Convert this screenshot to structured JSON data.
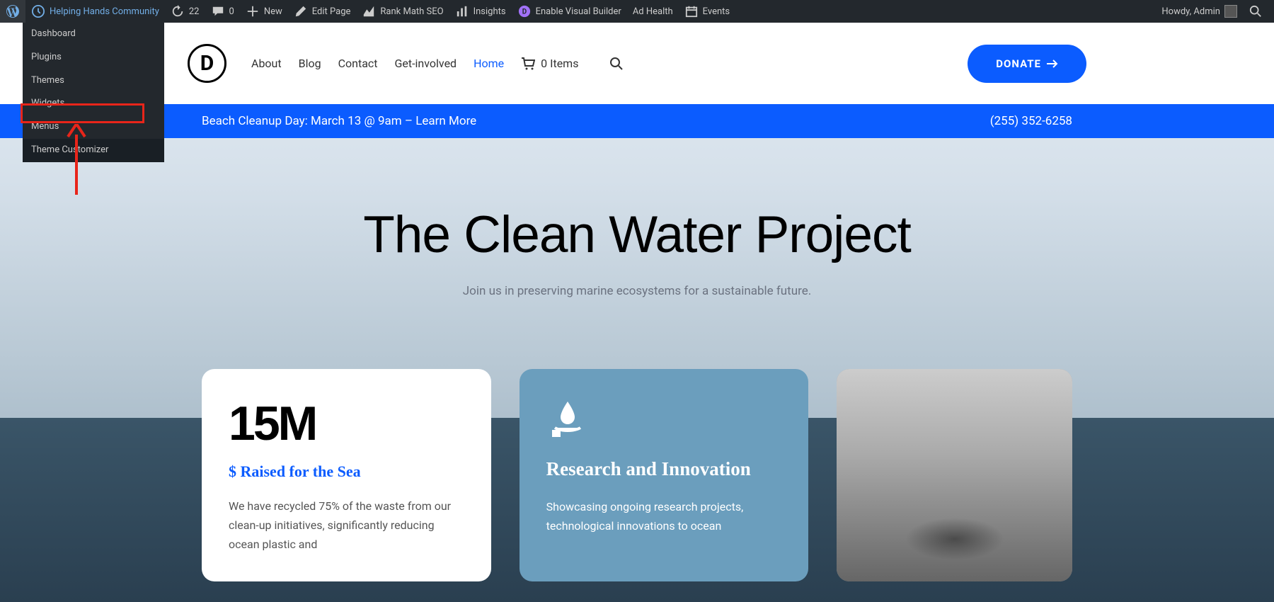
{
  "adminbar": {
    "site_name": "Helping Hands Community",
    "updates": "22",
    "comments": "0",
    "new": "New",
    "edit_page": "Edit Page",
    "rank_math": "Rank Math SEO",
    "insights": "Insights",
    "visual_builder": "Enable Visual Builder",
    "ad_health": "Ad Health",
    "events": "Events",
    "howdy": "Howdy, Admin"
  },
  "dropdown": {
    "items": [
      "Dashboard",
      "Plugins",
      "Themes",
      "Widgets",
      "Menus",
      "Theme Customizer"
    ]
  },
  "header": {
    "logo": "D",
    "nav": [
      "About",
      "Blog",
      "Contact",
      "Get-involved",
      "Home"
    ],
    "cart": "0 Items",
    "donate": "DONATE"
  },
  "announce": {
    "text": "Beach Cleanup Day: March 13 @ 9am – ",
    "link": "Learn More",
    "phone": "(255) 352-6258"
  },
  "hero": {
    "title": "The Clean Water Project",
    "subtitle": "Join us in preserving marine ecosystems for a sustainable future."
  },
  "cards": {
    "stat_value": "15M",
    "stat_label": "$ Raised for the Sea",
    "stat_body": "We have recycled 75% of the waste from our clean-up initiatives, significantly reducing ocean plastic and",
    "research_title": "Research and Innovation",
    "research_body": "Showcasing ongoing research projects, technological innovations to ocean"
  }
}
